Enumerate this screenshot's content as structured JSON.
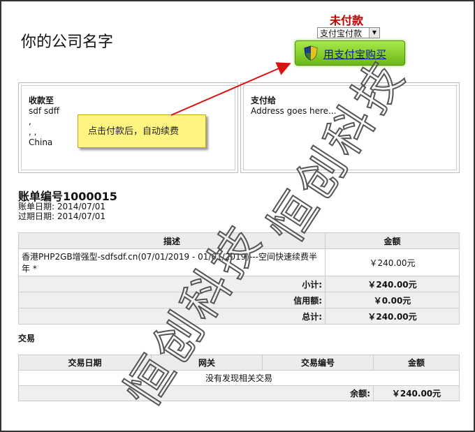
{
  "header": {
    "company_name": "你的公司名字",
    "status": "未付款",
    "payment_method": "支付宝付款",
    "pay_button_label": "用支付宝购买"
  },
  "invoiced_to": {
    "title": "收款至",
    "lines": "sdf sdff\n,\n, ,\nChina"
  },
  "pay_to": {
    "title": "支付给",
    "address": "Address goes here..."
  },
  "callout": "点击付款后，自动续费",
  "invoice": {
    "number": "账单编号1000015",
    "invoice_date": "账单日期: 2014/07/01",
    "due_date": "过期日期: 2014/07/01"
  },
  "items_table": {
    "headers": [
      "描述",
      "金额"
    ],
    "rows": [
      {
        "description": "香港PHP2GB增强型-sdfsdf.cn(07/01/2019 - 01/01/2019)---空间快速续费半年 *",
        "amount": "￥240.00元"
      }
    ],
    "subtotal_label": "小计:",
    "subtotal": "￥240.00元",
    "credit_label": "信用额:",
    "credit": "￥0.00元",
    "total_label": "总计:",
    "total": "￥240.00元"
  },
  "transactions": {
    "title": "交易",
    "headers": [
      "交易日期",
      "网关",
      "交易编号",
      "金额"
    ],
    "empty_text": "没有发现相关交易",
    "balance_label": "余额:",
    "balance": "￥240.00元"
  },
  "watermarks": [
    "恒创科技",
    "恒创科技"
  ],
  "colors": {
    "status": "#c00000",
    "pay_button": "#7cc628",
    "callout_bg": "#fdf580",
    "arrow": "#d11"
  }
}
